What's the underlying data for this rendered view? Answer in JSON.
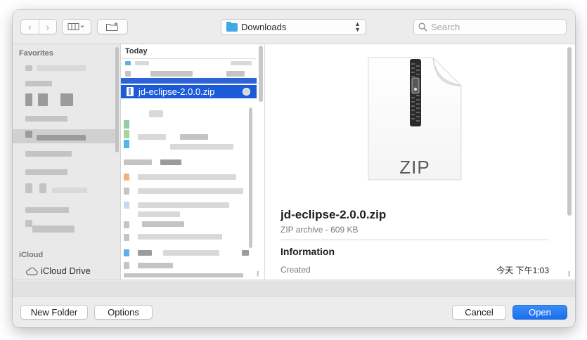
{
  "toolbar": {
    "back_glyph": "‹",
    "forward_glyph": "›",
    "view_icon": "columns-view-icon",
    "location_label": "Downloads",
    "search_placeholder": "Search"
  },
  "sidebar": {
    "favorites_header": "Favorites",
    "icloud_header": "iCloud",
    "icloud_drive_label": "iCloud Drive"
  },
  "file_list": {
    "group_header": "Today",
    "selected_file": "jd-eclipse-2.0.0.zip"
  },
  "preview": {
    "icon_label": "ZIP",
    "file_name": "jd-eclipse-2.0.0.zip",
    "kind_size": "ZIP archive - 609 KB",
    "info_header": "Information",
    "created_label": "Created",
    "created_value": "今天 下午1:03"
  },
  "buttons": {
    "new_folder": "New Folder",
    "options": "Options",
    "cancel": "Cancel",
    "open": "Open"
  },
  "colors": {
    "selection": "#1c5bd8",
    "primary_button": "#1a6fee",
    "folder_icon": "#3fa9e6"
  }
}
